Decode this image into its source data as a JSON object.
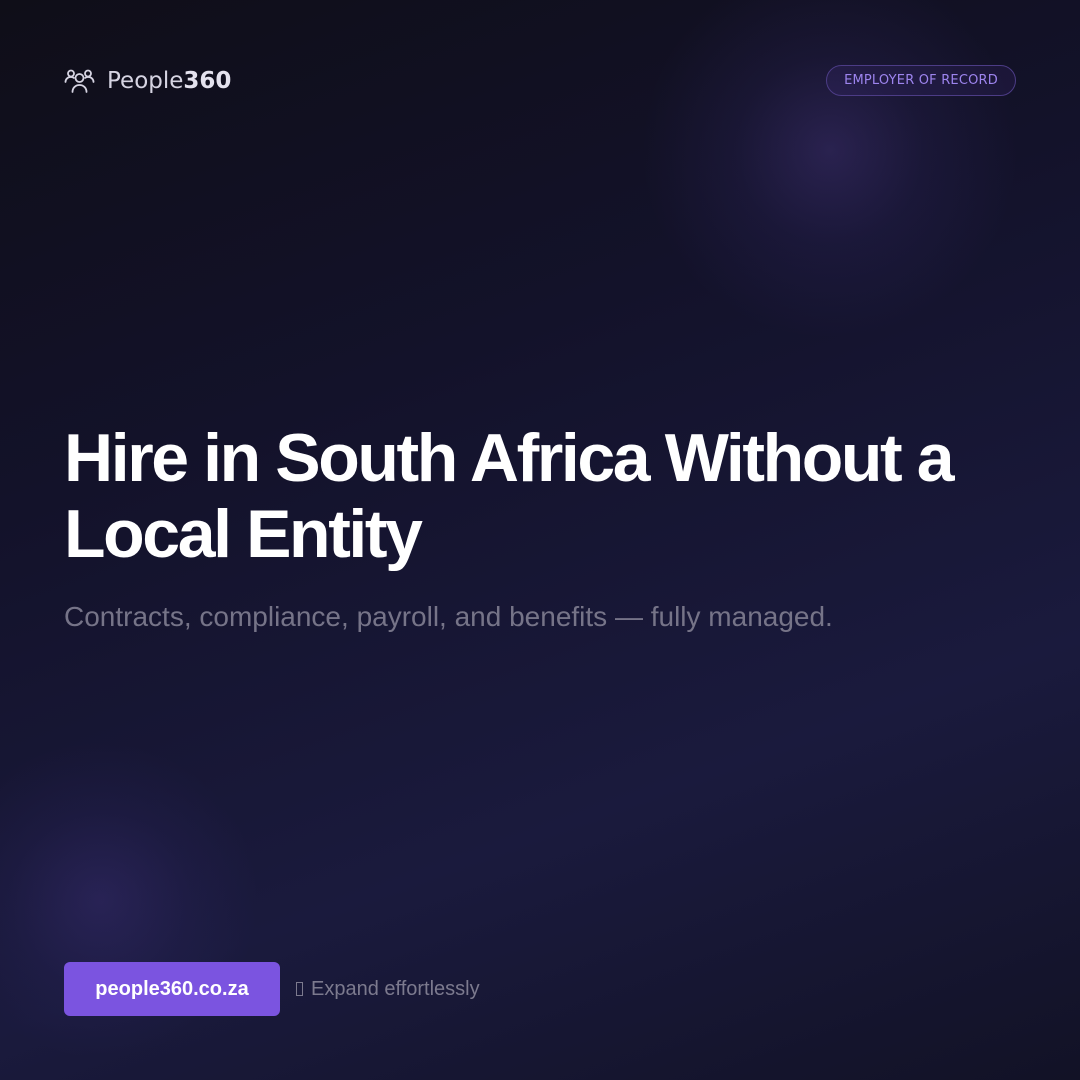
{
  "brand": {
    "name": "People",
    "number": "360"
  },
  "badge": {
    "label": "EMPLOYER OF RECORD"
  },
  "hero": {
    "headline": "Hire in South Africa Without a Local Entity",
    "subheadline": "Contracts, compliance, payroll, and benefits — fully managed."
  },
  "footer": {
    "cta_label": "people360.co.za",
    "tagline": "Expand effortlessly",
    "tagline_icon": "missing-glyph-icon"
  },
  "colors": {
    "accent": "#7b54e0",
    "badge_text": "#9d84ee",
    "background": "#13122a"
  },
  "icons": {
    "logo": "people-group-icon"
  }
}
